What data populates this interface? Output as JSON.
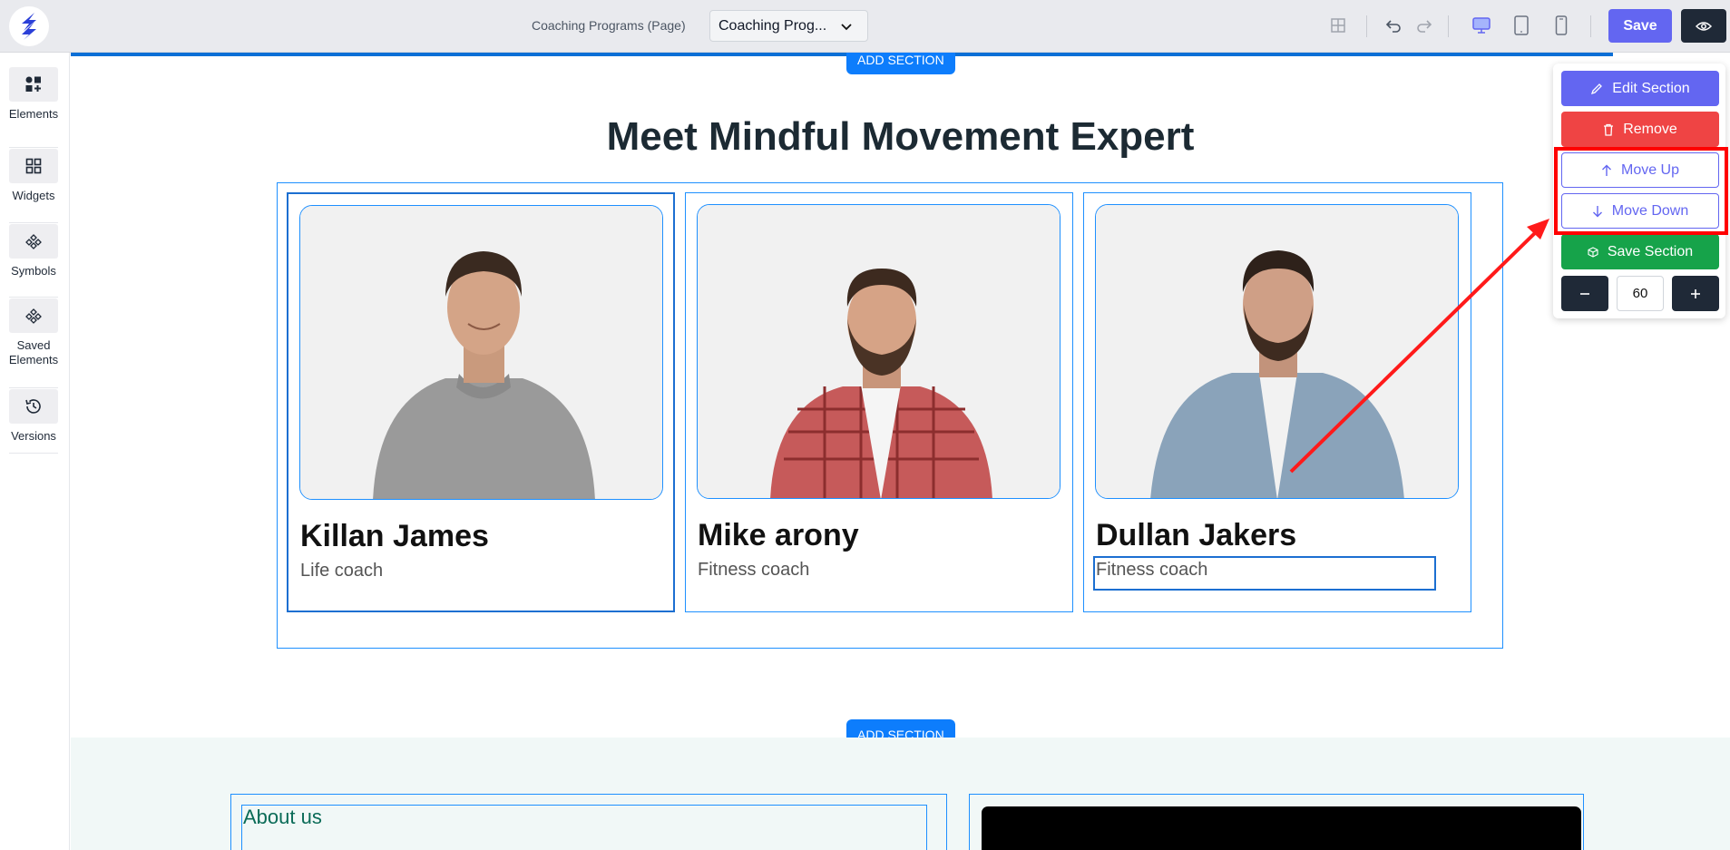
{
  "topbar": {
    "page_label": "Coaching Programs (Page)",
    "page_select_value": "Coaching Prog...",
    "save_label": "Save",
    "icons": [
      "grid-icon",
      "undo-icon",
      "redo-icon",
      "desktop-icon",
      "tablet-icon",
      "mobile-icon",
      "eye-icon"
    ]
  },
  "sidebar": {
    "items": [
      {
        "label": "Elements",
        "icon": "elements-icon"
      },
      {
        "label": "Widgets",
        "icon": "widgets-icon"
      },
      {
        "label": "Symbols",
        "icon": "symbols-icon"
      },
      {
        "label": "Saved Elements",
        "icon": "saved-elements-icon"
      },
      {
        "label": "Versions",
        "icon": "history-icon"
      }
    ]
  },
  "canvas": {
    "add_section_label": "ADD SECTION",
    "headline": "Meet Mindful Movement Expert",
    "team": [
      {
        "name": "Killan James",
        "role": "Life coach"
      },
      {
        "name": "Mike arony",
        "role": "Fitness coach"
      },
      {
        "name": "Dullan Jakers",
        "role": "Fitness coach"
      }
    ],
    "about_title": "About us"
  },
  "section_panel": {
    "edit_label": "Edit Section",
    "remove_label": "Remove",
    "move_up_label": "Move Up",
    "move_down_label": "Move Down",
    "save_section_label": "Save Section",
    "spacing_value": "60"
  },
  "colors": {
    "accent": "#6366f1",
    "danger": "#ef4444",
    "success": "#16a34a",
    "add_section": "#0d7dfc",
    "selection_border": "#1e90ff",
    "annotation": "#ff0000"
  }
}
